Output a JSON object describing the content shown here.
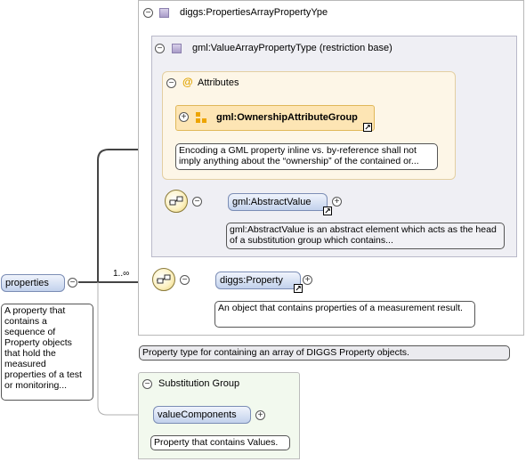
{
  "root_element": {
    "label": "properties",
    "doc": "A property that contains a sequence of Property objects that hold the measured properties of a test or monitoring..."
  },
  "complex_type": {
    "title": "diggs:PropertiesArrayPropertyYpe",
    "doc": "Property type for containing an array of DIGGS Property objects."
  },
  "base_type": {
    "title": "gml:ValueArrayPropertyType (restriction base)"
  },
  "attributes": {
    "title": "Attributes",
    "group_label": "gml:OwnershipAttributeGroup",
    "group_doc": "Encoding a GML property inline vs. by-reference shall not imply anything about the “ownership” of the contained or..."
  },
  "abstract_value": {
    "label": "gml:AbstractValue",
    "doc": "gml:AbstractValue is an abstract element which acts as the head of a substitution group which contains..."
  },
  "sequence": {
    "cardinality": "1..∞"
  },
  "property": {
    "label": "diggs:Property",
    "doc": "An object that contains properties of a measurement result."
  },
  "substitution_group": {
    "title": "Substitution Group",
    "member_label": "valueComponents",
    "member_doc": "Property that contains Values."
  },
  "colors": {
    "element_fill": "#c2d1ec",
    "base_type_fill": "#efeff4",
    "attributes_fill": "#fdf6e7",
    "attr_group_fill": "#fde5b4",
    "substitution_fill": "#f2f9ee"
  }
}
